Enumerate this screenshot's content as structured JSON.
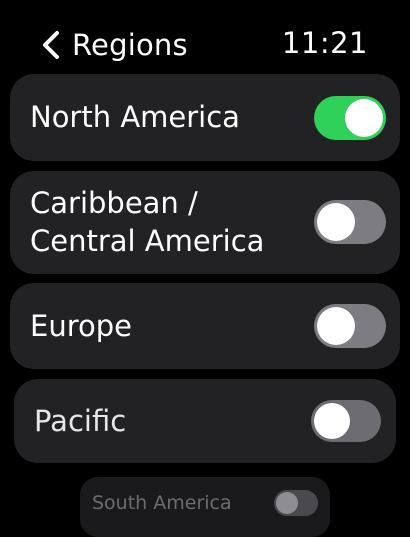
{
  "header": {
    "back_label": "Regions",
    "time": "11:21"
  },
  "rows": [
    {
      "label": "North America",
      "on": true
    },
    {
      "label": "Caribbean /\nCentral America",
      "on": false
    },
    {
      "label": "Europe",
      "on": false
    },
    {
      "label": "Pacific",
      "on": false
    },
    {
      "label": "South America",
      "on": false
    }
  ],
  "colors": {
    "toggle_on": "#30d158",
    "toggle_off": "#7c7c82",
    "row_background": "#222224",
    "screen_background": "#000000"
  }
}
